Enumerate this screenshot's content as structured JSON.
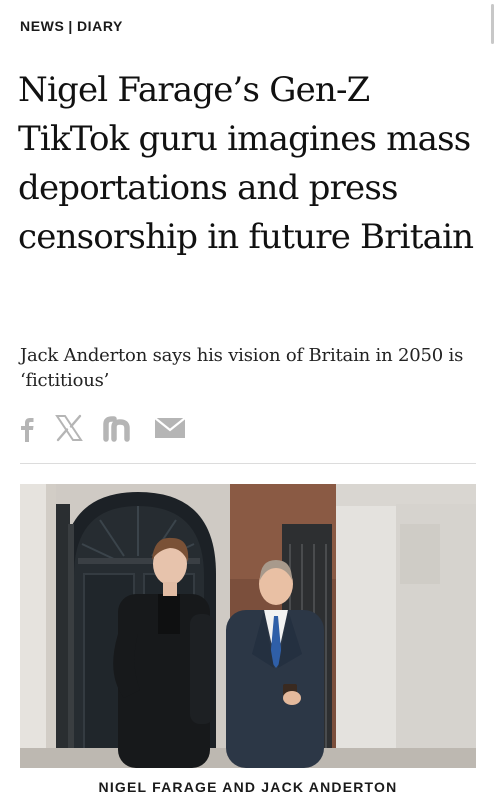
{
  "section": {
    "primary": "NEWS",
    "separator": "|",
    "secondary": "DIARY"
  },
  "article": {
    "headline": "Nigel Farage’s Gen-Z TikTok guru imagines mass deportations and press censorship in future Britain",
    "standfirst": "Jack Anderton says his vision of Britain in 2050 is ‘fictitious’"
  },
  "share": {
    "icons": [
      "facebook-icon",
      "x-icon",
      "news-n-icon",
      "email-icon"
    ],
    "icon_color": "#b5b5b5"
  },
  "image": {
    "caption": "NIGEL FARAGE AND JACK ANDERTON"
  }
}
